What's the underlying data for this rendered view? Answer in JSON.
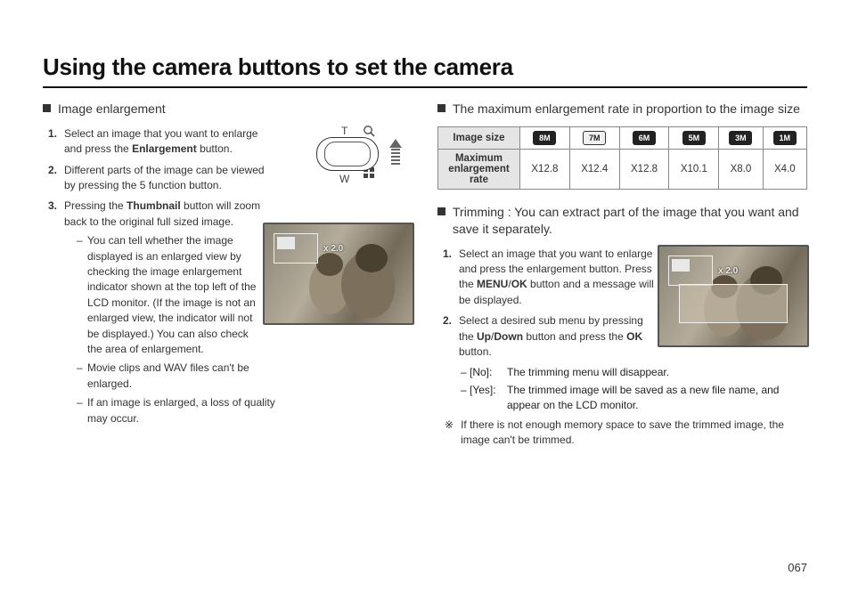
{
  "title": "Using the camera buttons to set the camera",
  "page_number": "067",
  "left": {
    "header": "Image enlargement",
    "steps": [
      {
        "n": "1.",
        "pre": "Select an image that you want to enlarge and press the ",
        "b": "Enlargement",
        "post": " button."
      },
      {
        "n": "2.",
        "pre": "Different parts of the image can be viewed by pressing the 5 function button.",
        "b": "",
        "post": ""
      },
      {
        "n": "3.",
        "pre": "Pressing the ",
        "b": "Thumbnail",
        "post": " button will zoom back to the original full sized image."
      }
    ],
    "sub": [
      "You can tell whether the image displayed is an enlarged view by checking the image enlargement indicator shown at the top left of the LCD monitor. (If the image is not an enlarged view, the indicator will not be displayed.) You can also check the area of enlargement.",
      "Movie clips and WAV files can't be enlarged.",
      "If an image is enlarged, a loss of quality may occur."
    ],
    "zoom_t": "T",
    "zoom_w": "W",
    "zoom_level_label": "x 2.0"
  },
  "right": {
    "header1": "The maximum enlargement rate in proportion to the image size",
    "table": {
      "row_h1": "Image size",
      "row_h2": "Maximum enlargement rate",
      "sizes": [
        "8M",
        "7M",
        "6M",
        "5M",
        "3M",
        "1M"
      ],
      "rates": [
        "X12.8",
        "X12.4",
        "X12.8",
        "X10.1",
        "X8.0",
        "X4.0"
      ]
    },
    "header2": "Trimming : You can extract part of the image that you want and save it separately.",
    "steps": [
      {
        "n": "1.",
        "pre": "Select an image that you want to enlarge and press the enlargement button. Press the ",
        "b": "MENU",
        "mid": "/",
        "b2": "OK",
        "post": " button and a message will be displayed."
      },
      {
        "n": "2.",
        "pre": "Select a desired sub menu by pressing the ",
        "b": "Up",
        "mid": "/",
        "b2": "Down",
        "post2": " button and press the ",
        "b3": "OK",
        "post": " button."
      }
    ],
    "opts": [
      {
        "k": "– [No]:",
        "v": "The trimming menu will disappear."
      },
      {
        "k": "– [Yes]:",
        "v": "The trimmed image will be saved as a new file name, and appear on the LCD monitor."
      }
    ],
    "note_star": "※",
    "note": "If there is not enough memory space to save the trimmed image, the image can't be trimmed.",
    "zoom_level_label": "x 2.0"
  }
}
